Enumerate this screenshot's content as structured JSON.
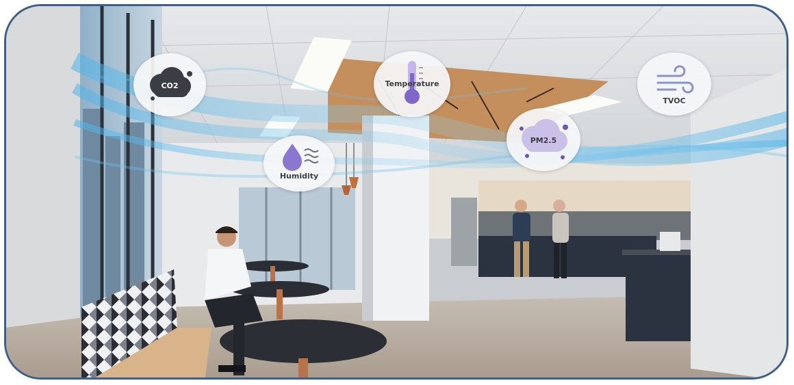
{
  "scene": {
    "description_colors": {
      "frame_border": "#3d5f86",
      "ceiling": "#dfe1e3",
      "wood_panel": "#c48f5c",
      "floor": "#b7aca0",
      "cabinet": "#2c3340",
      "wave": "#4fb3e8"
    }
  },
  "sensors": {
    "co2": {
      "label": "CO2",
      "icon": "cloud-icon"
    },
    "temperature": {
      "label": "Temperature",
      "icon": "thermometer-icon"
    },
    "humidity": {
      "label": "Humidity",
      "icon": "droplet-icon"
    },
    "pm25": {
      "label": "PM2.5",
      "icon": "particle-cloud-icon"
    },
    "tvoc": {
      "label": "TVOC",
      "icon": "wind-icon"
    }
  }
}
